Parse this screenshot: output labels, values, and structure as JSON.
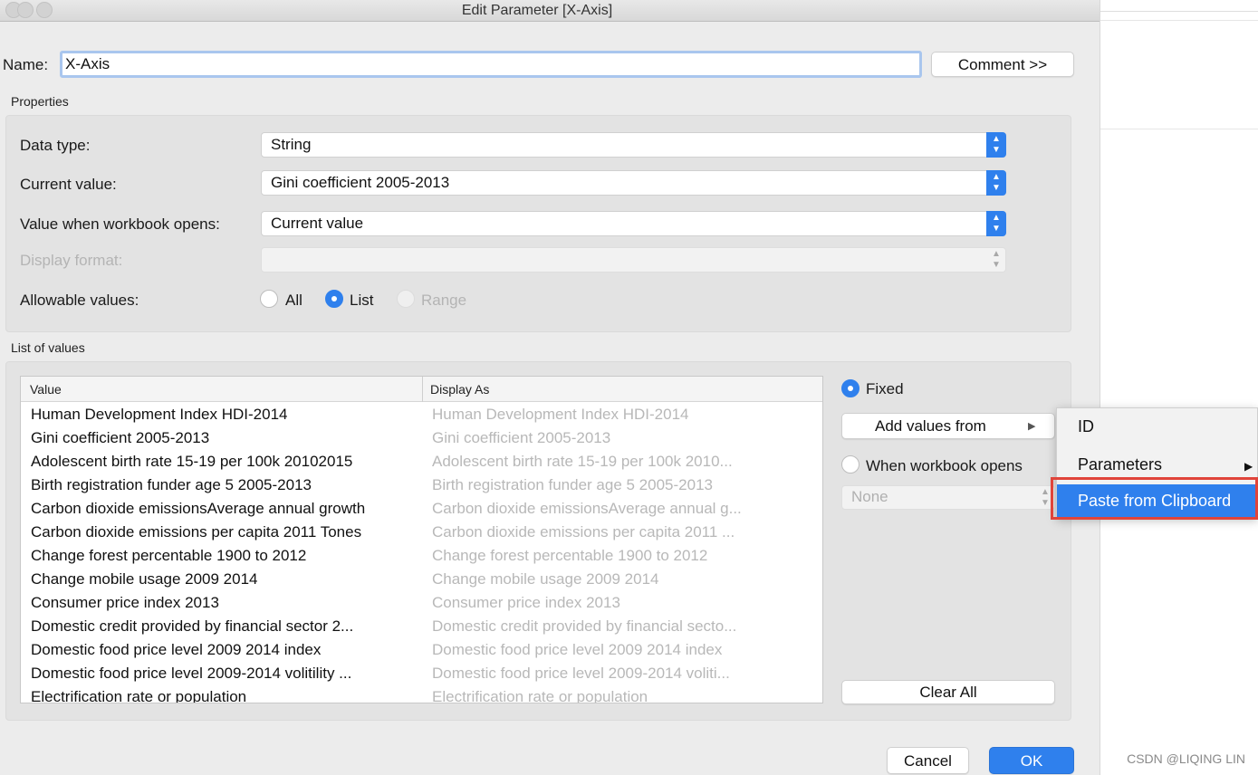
{
  "window": {
    "title": "Edit Parameter [X-Axis]"
  },
  "name": {
    "label": "Name:",
    "value": "X-Axis",
    "comment_button": "Comment >>"
  },
  "properties": {
    "heading": "Properties",
    "data_type": {
      "label": "Data type:",
      "value": "String"
    },
    "current_value": {
      "label": "Current value:",
      "value": "Gini coefficient 2005-2013"
    },
    "value_when_opens": {
      "label": "Value when workbook opens:",
      "value": "Current value"
    },
    "display_format": {
      "label": "Display format:",
      "value": ""
    },
    "allowable_values": {
      "label": "Allowable values:",
      "options": [
        "All",
        "List",
        "Range"
      ],
      "selected": "List"
    }
  },
  "list_of_values": {
    "heading": "List of values",
    "columns": [
      "Value",
      "Display As"
    ],
    "rows": [
      [
        "Human Development Index HDI-2014",
        "Human Development Index HDI-2014"
      ],
      [
        "Gini coefficient 2005-2013",
        "Gini coefficient 2005-2013"
      ],
      [
        "Adolescent birth rate 15-19 per 100k 20102015",
        "Adolescent birth rate 15-19 per 100k 2010..."
      ],
      [
        "Birth registration funder age 5 2005-2013",
        "Birth registration funder age 5 2005-2013"
      ],
      [
        "Carbon dioxide emissionsAverage annual growth",
        "Carbon dioxide emissionsAverage annual g..."
      ],
      [
        "Carbon dioxide emissions per capita 2011 Tones",
        "Carbon dioxide emissions per capita 2011 ..."
      ],
      [
        "Change forest percentable 1900 to 2012",
        "Change forest percentable 1900 to 2012"
      ],
      [
        "Change mobile usage 2009 2014",
        "Change mobile usage 2009 2014"
      ],
      [
        "Consumer price index 2013",
        "Consumer price index 2013"
      ],
      [
        "Domestic credit provided by financial sector 2...",
        "Domestic credit provided by financial secto..."
      ],
      [
        "Domestic food price level 2009 2014 index",
        "Domestic food price level 2009 2014 index"
      ],
      [
        "Domestic food price level 2009-2014 volitility ...",
        "Domestic food price level 2009-2014 voliti..."
      ],
      [
        "Electrification rate or population",
        "Electrification rate or population"
      ]
    ],
    "fixed_label": "Fixed",
    "add_values_button": "Add values from",
    "when_opens_label": "When workbook opens",
    "when_opens_select": "None",
    "clear_all_button": "Clear All"
  },
  "popup_menu": {
    "items": [
      {
        "label": "ID"
      },
      {
        "label": "Parameters"
      },
      {
        "label": "Paste from Clipboard"
      }
    ]
  },
  "footer": {
    "cancel_button": "Cancel",
    "ok_button": "OK"
  },
  "watermark": "CSDN @LIQING LIN",
  "colors": {
    "accent": "#2f80ed",
    "highlight_box": "#e0443a"
  }
}
